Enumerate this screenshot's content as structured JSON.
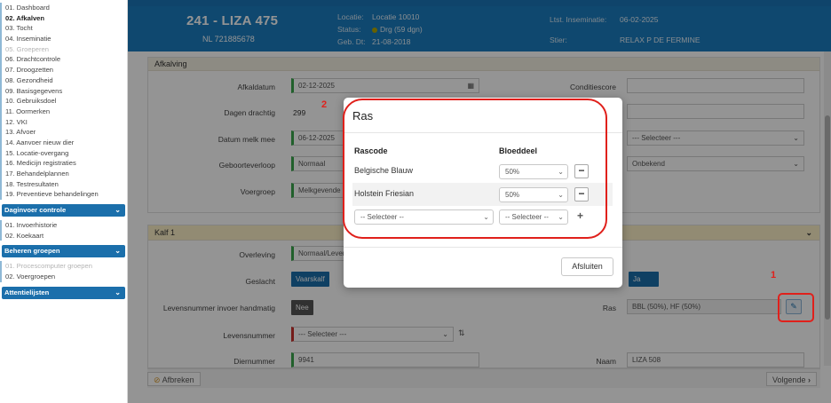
{
  "sidebar": {
    "items": [
      {
        "label": "01. Dashboard",
        "state": "normal"
      },
      {
        "label": "02. Afkalven",
        "state": "active"
      },
      {
        "label": "03. Tocht",
        "state": "normal"
      },
      {
        "label": "04. Inseminatie",
        "state": "normal"
      },
      {
        "label": "05. Groeperen",
        "state": "disabled"
      },
      {
        "label": "06. Drachtcontrole",
        "state": "normal"
      },
      {
        "label": "07. Droogzetten",
        "state": "normal"
      },
      {
        "label": "08. Gezondheid",
        "state": "normal"
      },
      {
        "label": "09. Basisgegevens",
        "state": "normal"
      },
      {
        "label": "10. Gebruiksdoel",
        "state": "normal"
      },
      {
        "label": "11. Oormerken",
        "state": "normal"
      },
      {
        "label": "12. VKI",
        "state": "normal"
      },
      {
        "label": "13. Afvoer",
        "state": "normal"
      },
      {
        "label": "14. Aanvoer nieuw dier",
        "state": "normal"
      },
      {
        "label": "15. Locatie-overgang",
        "state": "normal"
      },
      {
        "label": "16. Medicijn registraties",
        "state": "normal"
      },
      {
        "label": "17. Behandelplannen",
        "state": "normal"
      },
      {
        "label": "18. Testresultaten",
        "state": "normal"
      },
      {
        "label": "19. Preventieve behandelingen",
        "state": "normal"
      }
    ],
    "sections": [
      {
        "title": "Daginvoer controle",
        "items": [
          {
            "label": "01. Invoerhistorie",
            "state": "normal"
          },
          {
            "label": "02. Koekaart",
            "state": "normal"
          }
        ]
      },
      {
        "title": "Beheren groepen",
        "items": [
          {
            "label": "01. Procescomputer groepen",
            "state": "disabled"
          },
          {
            "label": "02. Voergroepen",
            "state": "normal"
          }
        ]
      },
      {
        "title": "Attentielijsten",
        "items": []
      }
    ]
  },
  "header": {
    "animal_name": "241 - LIZA 475",
    "nl_number": "NL 721885678",
    "locatie_label": "Locatie:",
    "locatie_value": "Locatie 10010",
    "status_label": "Status:",
    "status_value": "Drg (59 dgn)",
    "gebdt_label": "Geb. Dt:",
    "gebdt_value": "21-08-2018",
    "ltst_ins_label": "Ltst. Inseminatie:",
    "ltst_ins_value": "06-02-2025",
    "stier_label": "Stier:",
    "stier_value": "RELAX P DE FERMINE"
  },
  "afkalving": {
    "title": "Afkalving",
    "afkaldatum_label": "Afkaldatum",
    "afkaldatum_value": "02-12-2025",
    "dagen_drachtig_label": "Dagen drachtig",
    "dagen_drachtig_value": "299",
    "datum_melk_mee_label": "Datum melk mee",
    "datum_melk_mee_value": "06-12-2025",
    "geboorteverloop_label": "Geboorteverloop",
    "geboorteverloop_value": "Normaal",
    "voergroep_label": "Voergroep",
    "voergroep_value": "Melkgevende",
    "conditiescore_label": "Conditiescore",
    "right_select_placeholder": "--- Selecteer ---",
    "right_select_value": "Onbekend"
  },
  "kalf": {
    "title": "Kalf 1",
    "overleving_label": "Overleving",
    "overleving_value": "Normaal/Levend",
    "geslacht_label": "Geslacht",
    "geslacht_value": "Vaarskalf",
    "ja_label": "Ja",
    "levensnummer_handmatig_label": "Levensnummer invoer handmatig",
    "nee_label": "Nee",
    "ras_label": "Ras",
    "ras_value": "BBL (50%), HF (50%)",
    "levensnummer_label": "Levensnummer",
    "levensnummer_placeholder": "--- Selecteer ---",
    "diernummer_label": "Diernummer",
    "diernummer_value": "9941",
    "naam_label": "Naam",
    "naam_value": "LIZA 508"
  },
  "footer": {
    "afbreken_label": "Afbreken",
    "volgende_label": "Volgende"
  },
  "modal": {
    "title": "Ras",
    "col_rascode": "Rascode",
    "col_bloeddeel": "Bloeddeel",
    "rows": [
      {
        "rascode": "Belgische Blauw",
        "bloeddeel": "50%"
      },
      {
        "rascode": "Holstein Friesian",
        "bloeddeel": "50%"
      }
    ],
    "new_rascode_placeholder": "-- Selecteer --",
    "new_bloeddeel_placeholder": "-- Selecteer --",
    "close_label": "Afsluiten"
  },
  "annotations": {
    "marker_1": "1",
    "marker_2": "2"
  },
  "colors": {
    "header_blue": "#1b7dc0",
    "nav_blue": "#1b6fab",
    "annotation_red": "#e0201b",
    "valid_green": "#3aa64c",
    "required_red": "#c9302c"
  }
}
